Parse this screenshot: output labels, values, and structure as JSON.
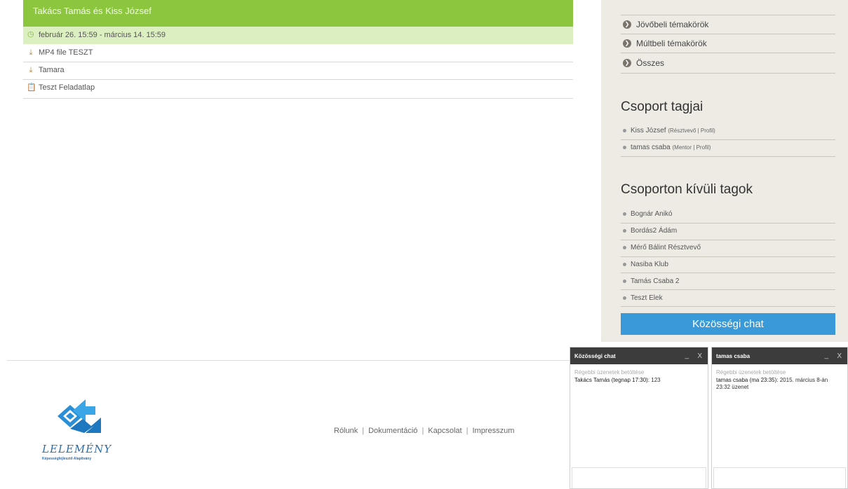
{
  "topic": {
    "title": "Takács Tamás és Kiss József",
    "date_range": "február 26. 15:59 - március 14. 15:59",
    "items": [
      {
        "icon": "download-icon",
        "label": "MP4 file TESZT"
      },
      {
        "icon": "download-icon",
        "label": "Tamara"
      },
      {
        "icon": "clipboard-icon",
        "label": "Teszt Feladatlap"
      }
    ]
  },
  "sidebar": {
    "categories": [
      {
        "label": "Jövőbeli témakörök"
      },
      {
        "label": "Múltbeli témakörök"
      },
      {
        "label": "Összes"
      }
    ],
    "group_members_title": "Csoport tagjai",
    "group_members": [
      {
        "name": "Kiss József",
        "role": "(Résztvevő | Profil)"
      },
      {
        "name": "tamas csaba",
        "role": "(Mentor | Profil)"
      }
    ],
    "outside_members_title": "Csoporton kívüli tagok",
    "outside_members": [
      {
        "name": "Bognár Anikó"
      },
      {
        "name": "Bordás2 Ádám"
      },
      {
        "name": "Mérő Bálint Résztvevő"
      },
      {
        "name": "Nasiba Klub"
      },
      {
        "name": "Tamás Csaba 2"
      },
      {
        "name": "Teszt Elek"
      }
    ],
    "chat_button": "Közösségi chat"
  },
  "footer": {
    "logo_text": "LELEMÉNY",
    "logo_sub": "Képességfejlesztő Alapítvány",
    "links": [
      "Rólunk",
      "Dokumentáció",
      "Kapcsolat",
      "Impresszum"
    ],
    "separator": "|"
  },
  "chats": [
    {
      "title": "Közösségi chat",
      "minimize": "_",
      "close": "X",
      "older": "Régebbi üzenetek betöltése",
      "message_from": "Takács Tamás (tegnap 17:30):",
      "message_text": "123"
    },
    {
      "title": "tamas csaba",
      "minimize": "_",
      "close": "X",
      "older": "Régebbi üzenetek betöltése",
      "message_from": "tamas csaba (ma 23:35):",
      "message_text": "2015. március 8-án 23:32 üzenet"
    }
  ],
  "colors": {
    "topic_header": "#8cc63f",
    "date_row": "#dcefc0",
    "sidebar_bg": "#edebe4",
    "chat_button": "#3a9ad9",
    "chat_header": "#3c3c3c"
  }
}
